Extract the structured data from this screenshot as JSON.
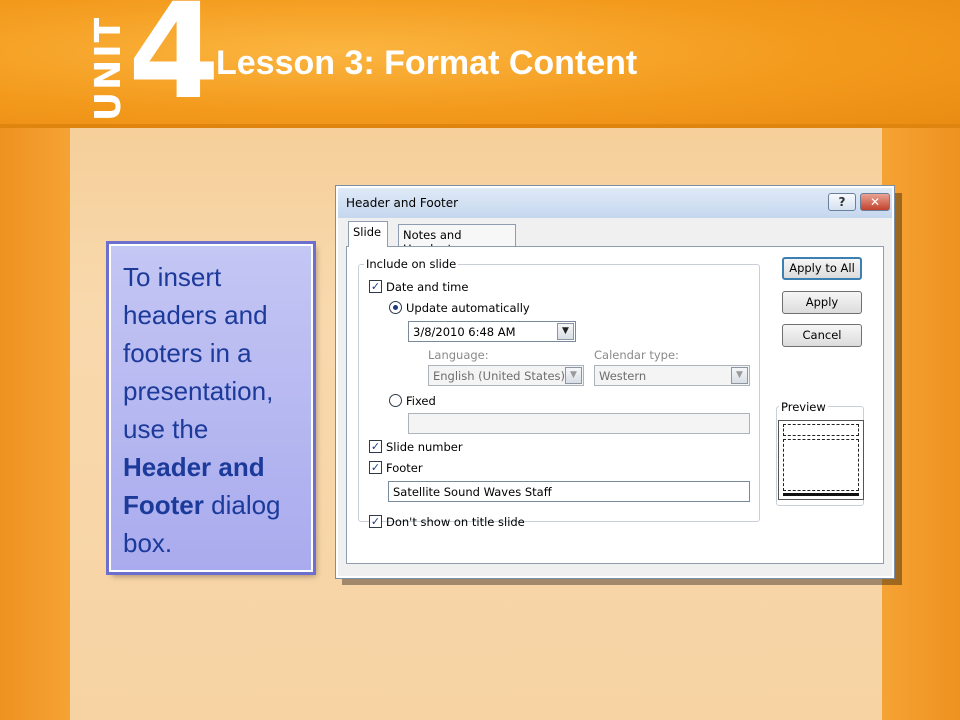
{
  "slide": {
    "unit_word": "UNIT",
    "unit_number": "4",
    "lesson_title": "Lesson 3: Format Content",
    "callout": {
      "line1": "To insert headers and footers in a presentation, use the",
      "bold": "Header and Footer",
      "line2": "dialog box."
    }
  },
  "dialog": {
    "title": "Header and Footer",
    "help_label": "?",
    "close_label": "✕",
    "tabs": [
      {
        "label": "Slide",
        "active": true
      },
      {
        "label": "Notes and Handouts",
        "active": false
      }
    ],
    "include_group_label": "Include on slide",
    "date_and_time": {
      "label": "Date and time",
      "checked": true
    },
    "update_automatically": {
      "label": "Update automatically",
      "selected": true
    },
    "date_value": "3/8/2010 6:48 AM",
    "language_label": "Language:",
    "language_value": "English (United States)",
    "calendar_label": "Calendar type:",
    "calendar_value": "Western",
    "fixed": {
      "label": "Fixed",
      "selected": false
    },
    "fixed_value": "",
    "slide_number": {
      "label": "Slide number",
      "checked": true
    },
    "footer": {
      "label": "Footer",
      "checked": true
    },
    "footer_value": "Satellite Sound Waves Staff",
    "dont_show_title": {
      "label": "Don't show on title slide",
      "checked": true
    },
    "buttons": {
      "apply_to_all": "Apply to All",
      "apply": "Apply",
      "cancel": "Cancel"
    },
    "preview_label": "Preview",
    "dropdown_arrow": "▼"
  },
  "colors": {
    "header_orange": "#f39a1c",
    "callout_text": "#1b3a9a",
    "callout_fill": "#b6b8f0"
  }
}
